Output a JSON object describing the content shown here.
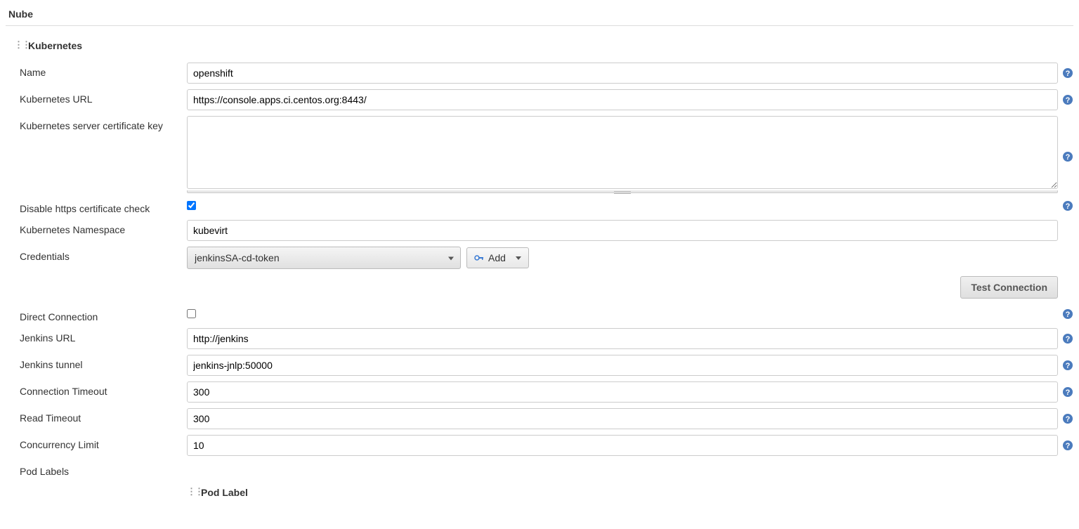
{
  "page": {
    "title": "Nube",
    "section_title": "Kubernetes"
  },
  "fields": {
    "name": {
      "label": "Name",
      "value": "openshift"
    },
    "k8s_url": {
      "label": "Kubernetes URL",
      "value": "https://console.apps.ci.centos.org:8443/"
    },
    "cert_key": {
      "label": "Kubernetes server certificate key",
      "value": ""
    },
    "disable_https": {
      "label": "Disable https certificate check",
      "checked": true
    },
    "namespace": {
      "label": "Kubernetes Namespace",
      "value": "kubevirt"
    },
    "credentials": {
      "label": "Credentials",
      "selected": "jenkinsSA-cd-token",
      "add_label": "Add"
    },
    "test_connection": {
      "label": "Test Connection"
    },
    "direct_connection": {
      "label": "Direct Connection",
      "checked": false
    },
    "jenkins_url": {
      "label": "Jenkins URL",
      "value": "http://jenkins"
    },
    "jenkins_tunnel": {
      "label": "Jenkins tunnel",
      "value": "jenkins-jnlp:50000"
    },
    "connection_timeout": {
      "label": "Connection Timeout",
      "value": "300"
    },
    "read_timeout": {
      "label": "Read Timeout",
      "value": "300"
    },
    "concurrency_limit": {
      "label": "Concurrency Limit",
      "value": "10"
    },
    "pod_labels": {
      "label": "Pod Labels",
      "sub_label": "Pod Label"
    }
  }
}
